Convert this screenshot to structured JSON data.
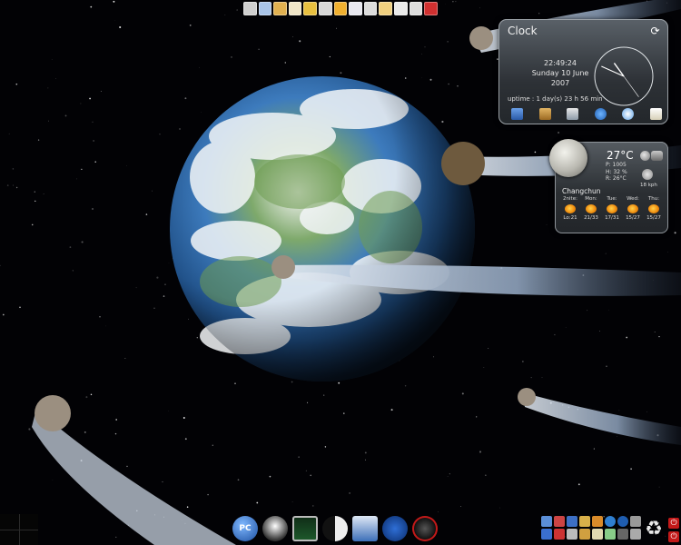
{
  "top_bar": {
    "icons": [
      "penguin-settings-icon",
      "window-icon",
      "folder-icon",
      "document-icon",
      "paint-icon",
      "speaker-icon",
      "clock-icon",
      "notes-icon",
      "list-icon",
      "calendar-icon",
      "mail-icon",
      "terminal-icon",
      "red-app-icon"
    ]
  },
  "clock_widget": {
    "title": "Clock",
    "time": "22:49:24",
    "date_line1": "Sunday 10 June",
    "date_line2": "2007",
    "uptime": "uptime : 1 day(s) 23 h 56 min",
    "hands": {
      "hour": 10.8,
      "minute": 49,
      "second": 24
    }
  },
  "weather_widget": {
    "temperature": "27°C",
    "pressure": "P: 1005",
    "humidity": "H: 32 %",
    "realfeel": "R: 26°C",
    "wind": "18 kph",
    "city": "Changchun",
    "forecast": [
      {
        "day": "2nite:",
        "temps": "Lo:21"
      },
      {
        "day": "Mon:",
        "temps": "21/33"
      },
      {
        "day": "Tue:",
        "temps": "17/31"
      },
      {
        "day": "Wed:",
        "temps": "15/27"
      },
      {
        "day": "Thu:",
        "temps": "15/27"
      }
    ]
  },
  "bottom_dock": {
    "pc_label": "PC",
    "items": [
      "computer-icon",
      "penguin-icon",
      "monitor-icon",
      "yin-yang-icon",
      "settings-icon",
      "tools-icon",
      "media-icon"
    ]
  },
  "colors": {
    "widget_border": "#9aa0a6",
    "accent_red": "#c31919"
  }
}
